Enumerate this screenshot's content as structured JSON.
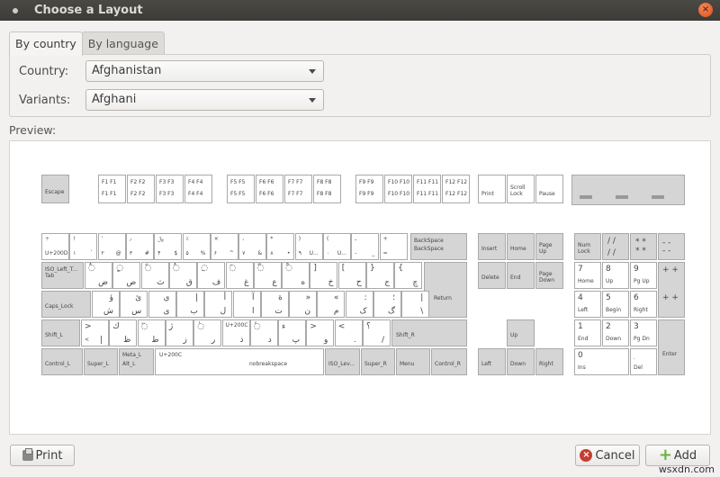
{
  "window": {
    "title": "Choose a Layout"
  },
  "tabs": [
    {
      "label": "By country",
      "active": true
    },
    {
      "label": "By language",
      "active": false
    }
  ],
  "form": {
    "country_label": "Country:",
    "country_value": "Afghanistan",
    "variants_label": "Variants:",
    "variants_value": "Afghani"
  },
  "preview_label": "Preview:",
  "keyboard": {
    "escape": "Escape",
    "fkeys": [
      [
        "F1",
        "F1"
      ],
      [
        "F2",
        "F2"
      ],
      [
        "F3",
        "F3"
      ],
      [
        "F4",
        "F4"
      ],
      [
        "F5",
        "F5"
      ],
      [
        "F6",
        "F6"
      ],
      [
        "F7",
        "F7"
      ],
      [
        "F8",
        "F8"
      ],
      [
        "F9",
        "F9"
      ],
      [
        "F10",
        "F10"
      ],
      [
        "F11",
        "F11"
      ],
      [
        "F12",
        "F12"
      ]
    ],
    "print": "Print",
    "scroll_lock": "Scroll Lock",
    "pause": "Pause",
    "row1": [
      {
        "tl": "÷",
        "bl": "U+200D",
        "tr": "",
        "br": ""
      },
      {
        "tl": "!",
        "bl": "۱",
        "tr": "",
        "br": "`"
      },
      {
        "tl": "٬",
        "bl": "۲",
        "tr": "",
        "br": "@"
      },
      {
        "tl": "٫",
        "bl": "۳",
        "tr": "",
        "br": "#"
      },
      {
        "tl": "﷼",
        "bl": "۴",
        "tr": "",
        "br": "$"
      },
      {
        "tl": "٪",
        "bl": "۵",
        "tr": "",
        "br": "%"
      },
      {
        "tl": "×",
        "bl": "۶",
        "tr": "",
        "br": "^"
      },
      {
        "tl": "،",
        "bl": "۷",
        "tr": "",
        "br": "&"
      },
      {
        "tl": "*",
        "bl": "۸",
        "tr": "",
        "br": "•"
      },
      {
        "tl": ")",
        "bl": "۹",
        "tr": "",
        "br": "U..."
      },
      {
        "tl": "(",
        "bl": "۰",
        "tr": "",
        "br": "U..."
      },
      {
        "tl": "ـ",
        "bl": "-",
        "tr": "",
        "br": "_"
      },
      {
        "tl": "+",
        "bl": "=",
        "tr": "",
        "br": ""
      }
    ],
    "backspace": [
      "BackSpace",
      "BackSpace"
    ],
    "tab": [
      "ISO_Left_T...",
      "Tab"
    ],
    "row2": [
      {
        "tl": "◌ٌ",
        "br": "ض"
      },
      {
        "tl": "◌ٍ",
        "br": "ص"
      },
      {
        "tl": "◌ً",
        "br": "ث"
      },
      {
        "tl": "◌ُ",
        "br": "ق"
      },
      {
        "tl": "◌ِ",
        "br": "ف"
      },
      {
        "tl": "◌َ",
        "br": "غ"
      },
      {
        "tl": "◌ّ",
        "br": "ع"
      },
      {
        "tl": "◌ْ",
        "br": "ه"
      },
      {
        "tl": "]",
        "br": "خ"
      },
      {
        "tl": "[",
        "br": "ح"
      },
      {
        "tl": "}",
        "br": "ج"
      },
      {
        "tl": "{",
        "br": "چ"
      }
    ],
    "caps_lock": "Caps_Lock",
    "row3": [
      {
        "tl": "ؤ",
        "br": "ش"
      },
      {
        "tl": "ئ",
        "br": "س"
      },
      {
        "tl": "ي",
        "br": "ی"
      },
      {
        "tl": "إ",
        "br": "ب"
      },
      {
        "tl": "أ",
        "br": "ل"
      },
      {
        "tl": "آ",
        "br": "ا"
      },
      {
        "tl": "ة",
        "br": "ت"
      },
      {
        "tl": "»",
        "br": "ن"
      },
      {
        "tl": "«",
        "br": "م"
      },
      {
        "tl": ":",
        "br": "ک"
      },
      {
        "tl": "؛",
        "br": "گ"
      },
      {
        "tl": "|",
        "br": "\\"
      }
    ],
    "return": "Return",
    "shift_l": "Shift_L",
    "row4": [
      {
        "tl": ">",
        "bl": "<",
        "tr": "¦",
        "br": "|"
      },
      {
        "tl": "ك",
        "br": "ظ"
      },
      {
        "tl": "◌ٓ",
        "br": "ط"
      },
      {
        "tl": "ژ",
        "br": "ز"
      },
      {
        "tl": "◌ٰ",
        "br": "ر"
      },
      {
        "tl": "U+200C",
        "br": "ذ"
      },
      {
        "tl": "◌ٔ",
        "br": "د"
      },
      {
        "tl": "ء",
        "br": "پ"
      },
      {
        "tl": ">",
        "br": "و"
      },
      {
        "tl": "<",
        "br": "."
      },
      {
        "tl": "؟",
        "br": "/"
      }
    ],
    "shift_r": "Shift_R",
    "control_l": "Control_L",
    "super_l": "Super_L",
    "alt_l": [
      "Meta_L",
      "Alt_L"
    ],
    "space": [
      "U+200C",
      "nobreakspace"
    ],
    "iso_level": "ISO_Lev...",
    "super_r": "Super_R",
    "menu": "Menu",
    "control_r": "Control_R",
    "nav": [
      "Insert",
      "Home",
      "Page Up",
      "Delete",
      "End",
      "Page Down"
    ],
    "arrows": [
      "Up",
      "Left",
      "Down",
      "Right"
    ],
    "numpad": {
      "num_lock": "Num Lock",
      "divide": "/",
      "multiply": "*",
      "minus": "-",
      "plus": "+",
      "enter": "Enter",
      "keys": [
        [
          "7",
          "Home"
        ],
        [
          "8",
          "Up"
        ],
        [
          "9",
          "Pg Up"
        ],
        [
          "4",
          "Left"
        ],
        [
          "5",
          "Begin"
        ],
        [
          "6",
          "Right"
        ],
        [
          "1",
          "End"
        ],
        [
          "2",
          "Down"
        ],
        [
          "3",
          "Pg Dn"
        ],
        [
          "0",
          "Ins"
        ],
        [
          ".",
          "Del"
        ]
      ]
    }
  },
  "buttons": {
    "print": "Print",
    "cancel": "Cancel",
    "add": "Add"
  },
  "watermark": "wsxdn.com"
}
